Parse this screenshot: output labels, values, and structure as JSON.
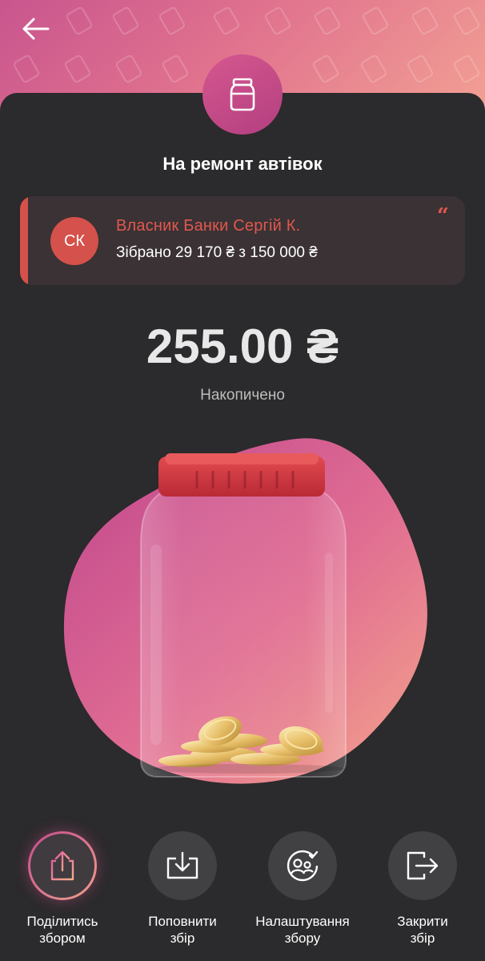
{
  "header": {
    "back_label": ""
  },
  "collection": {
    "title": "На ремонт автівок",
    "owner": {
      "initials": "СК",
      "name": "Власник Банки Сергій К.",
      "progress_text": "Зібрано 29 170 ₴ з 150 000 ₴"
    },
    "quote_mark": "“"
  },
  "balance": {
    "amount": "255.00 ₴",
    "label": "Накопичено"
  },
  "actions": [
    {
      "label": "Поділитись\nзбором",
      "icon": "share-icon"
    },
    {
      "label": "Поповнити\nзбір",
      "icon": "top-up-icon"
    },
    {
      "label": "Налаштування\nзбору",
      "icon": "settings-user-icon"
    },
    {
      "label": "Закрити\nзбір",
      "icon": "exit-icon"
    }
  ],
  "colors": {
    "accent": "#d5514b",
    "header_gradient_start": "#c9558e",
    "header_gradient_end": "#f3a294",
    "background": "#2b2a2c"
  }
}
